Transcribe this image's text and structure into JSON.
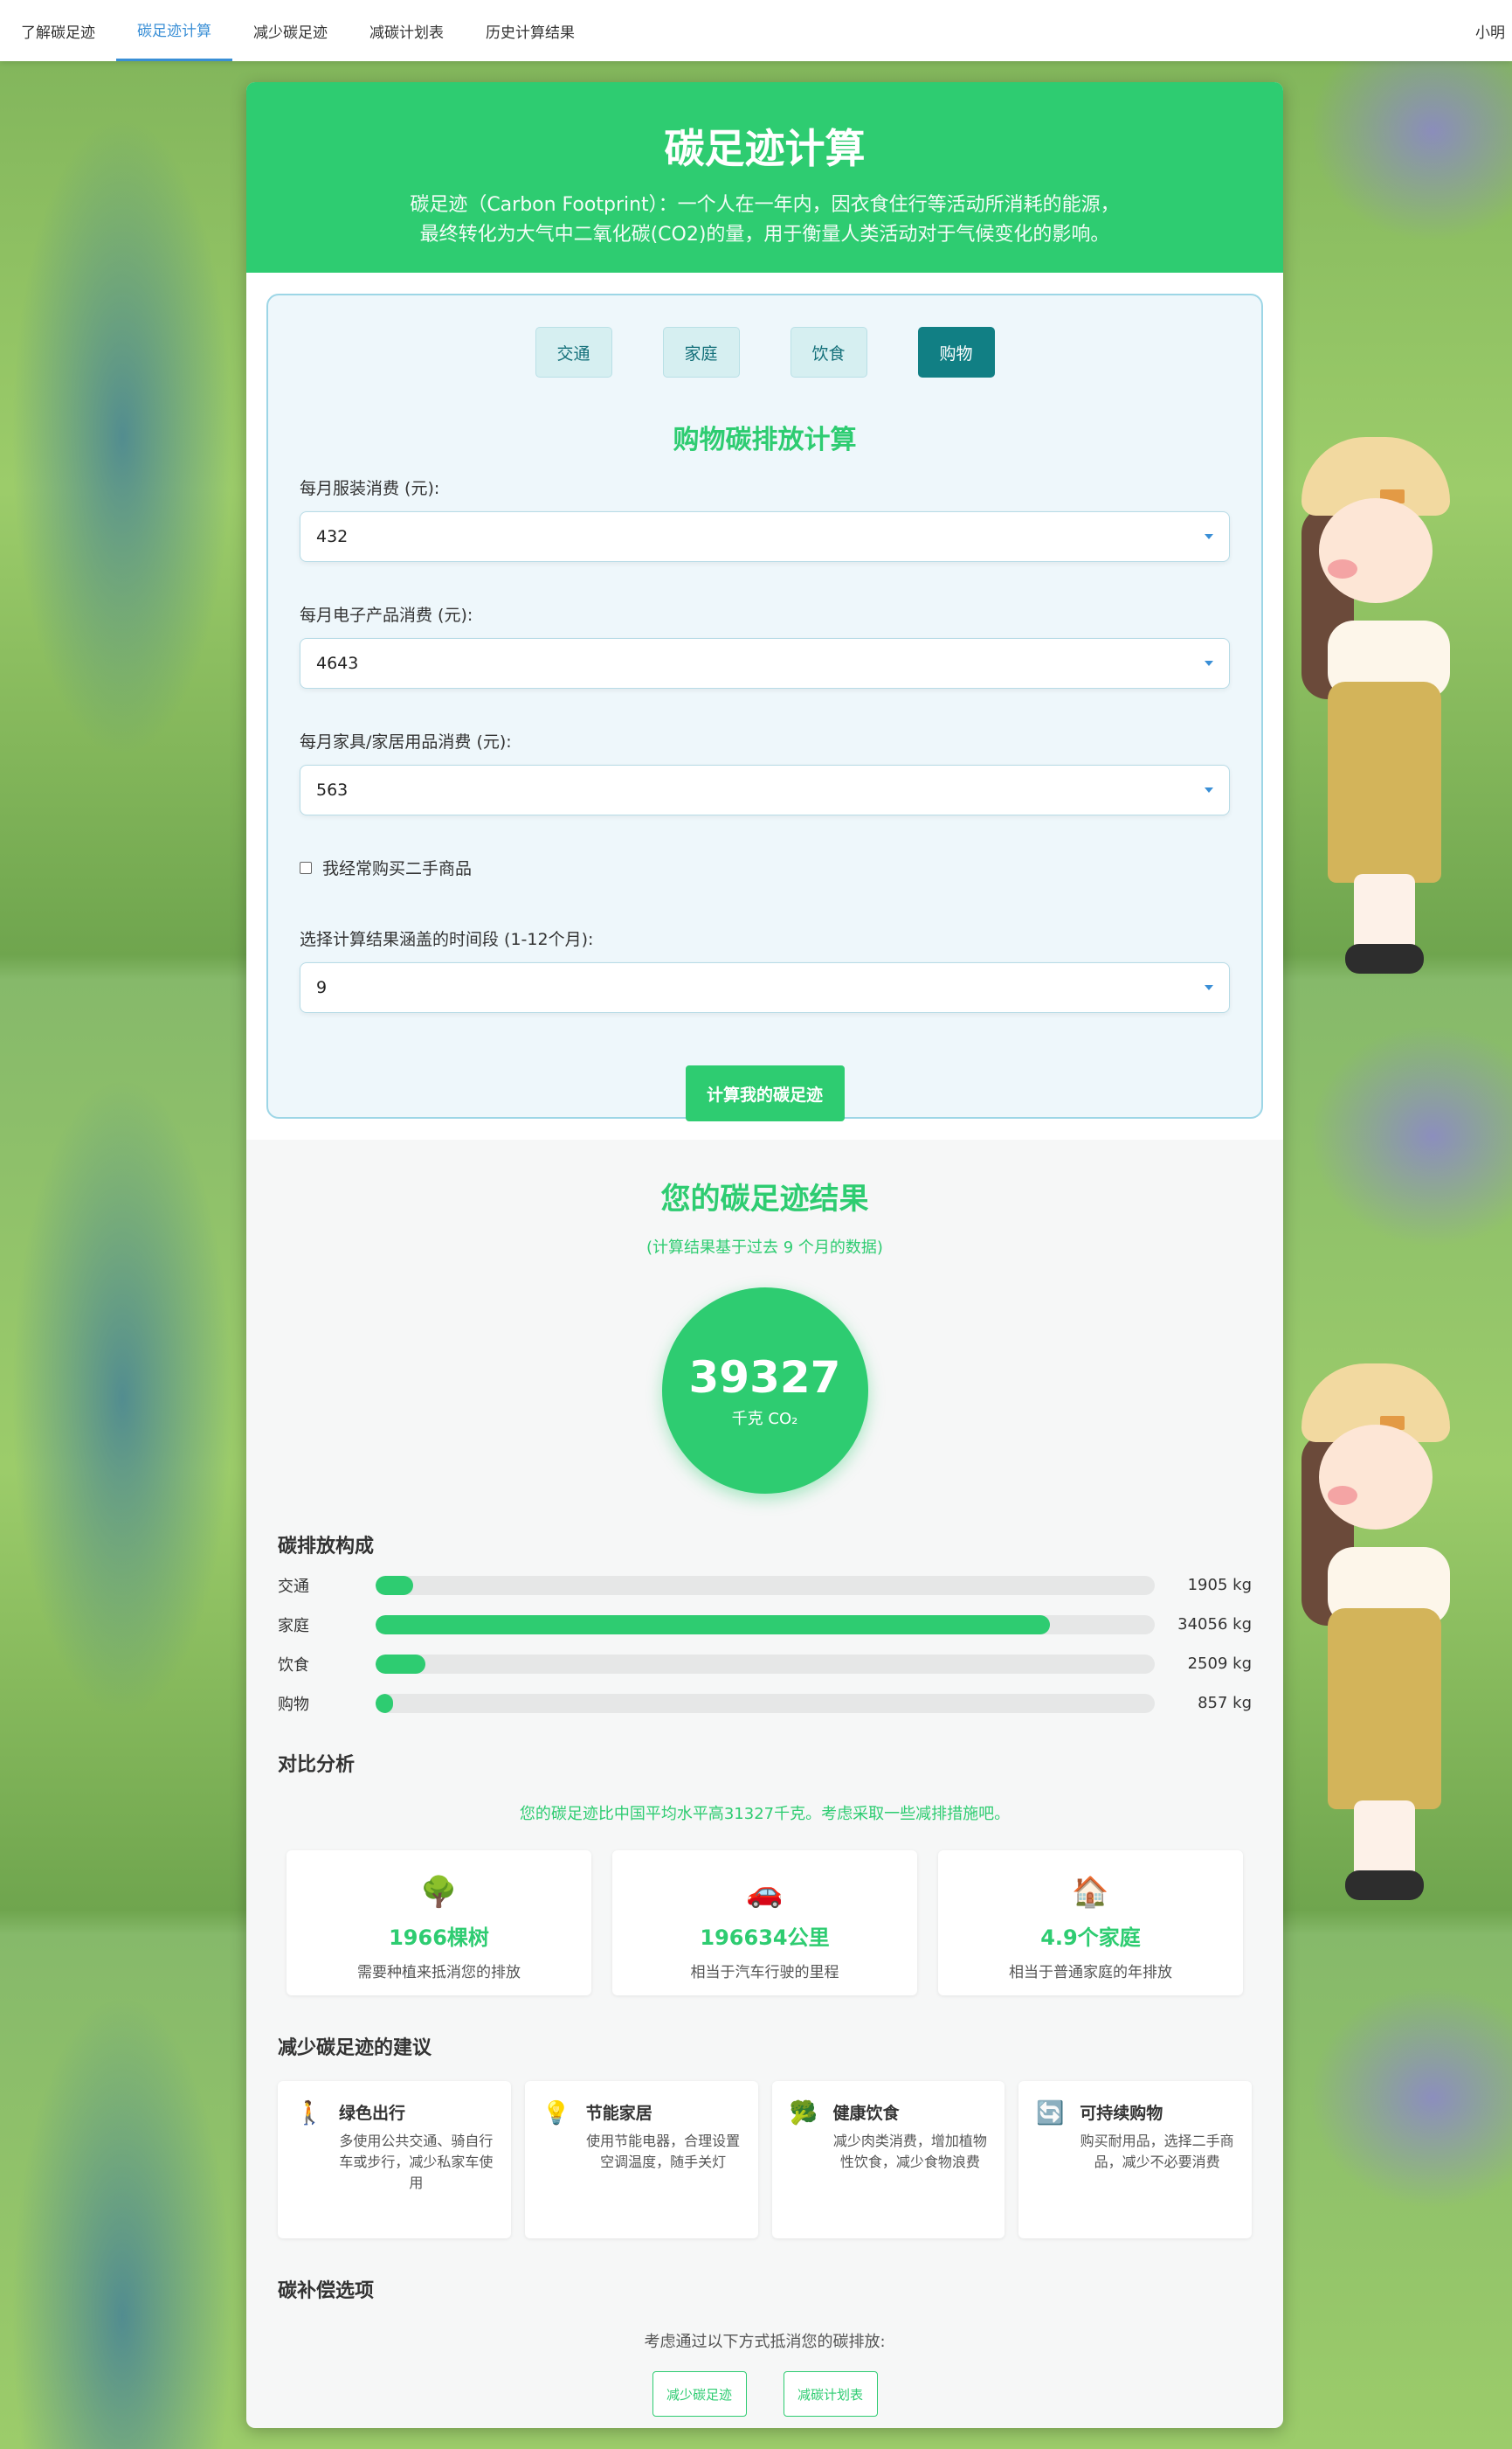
{
  "nav": {
    "items": [
      {
        "label": "了解碳足迹",
        "active": false
      },
      {
        "label": "碳足迹计算",
        "active": true
      },
      {
        "label": "减少碳足迹",
        "active": false
      },
      {
        "label": "减碳计划表",
        "active": false
      },
      {
        "label": "历史计算结果",
        "active": false
      }
    ],
    "user": "小明"
  },
  "hero": {
    "title": "碳足迹计算",
    "desc_line1": "碳足迹（Carbon Footprint）：一个人在一年内，因衣食住行等活动所消耗的能源，",
    "desc_line2": "最终转化为大气中二氧化碳(CO2)的量，用于衡量人类活动对于气候变化的影响。"
  },
  "tabs": [
    {
      "label": "交通",
      "active": false
    },
    {
      "label": "家庭",
      "active": false
    },
    {
      "label": "饮食",
      "active": false
    },
    {
      "label": "购物",
      "active": true
    }
  ],
  "form": {
    "title": "购物碳排放计算",
    "clothing_label": "每月服装消费 (元):",
    "clothing_value": "432",
    "electronics_label": "每月电子产品消费 (元):",
    "electronics_value": "4643",
    "furniture_label": "每月家具/家居用品消费 (元):",
    "furniture_value": "563",
    "secondhand_label": "我经常购买二手商品",
    "secondhand_checked": false,
    "period_label": "选择计算结果涵盖的时间段 (1-12个月):",
    "period_value": "9",
    "submit_label": "计算我的碳足迹"
  },
  "result": {
    "title": "您的碳足迹结果",
    "subtitle": "(计算结果基于过去 9 个月的数据)",
    "total": "39327",
    "unit": "千克 CO₂"
  },
  "breakdown": {
    "title": "碳排放构成",
    "items": [
      {
        "label": "交通",
        "value": "1905 kg",
        "fraction": 0.048
      },
      {
        "label": "家庭",
        "value": "34056 kg",
        "fraction": 0.866
      },
      {
        "label": "饮食",
        "value": "2509 kg",
        "fraction": 0.064
      },
      {
        "label": "购物",
        "value": "857 kg",
        "fraction": 0.022
      }
    ]
  },
  "comparison": {
    "title": "对比分析",
    "text": "您的碳足迹比中国平均水平高31327千克。考虑采取一些减排措施吧。",
    "cards": [
      {
        "icon": "tree-icon",
        "glyph": "🌳",
        "value": "1966棵树",
        "desc": "需要种植来抵消您的排放"
      },
      {
        "icon": "car-icon",
        "glyph": "🚗",
        "value": "196634公里",
        "desc": "相当于汽车行驶的里程"
      },
      {
        "icon": "house-icon",
        "glyph": "🏠",
        "value": "4.9个家庭",
        "desc": "相当于普通家庭的年排放"
      }
    ]
  },
  "tips": {
    "title": "减少碳足迹的建议",
    "items": [
      {
        "icon": "walking-icon",
        "glyph": "🚶",
        "title": "绿色出行",
        "desc": "多使用公共交通、骑自行车或步行，减少私家车使用"
      },
      {
        "icon": "lightbulb-icon",
        "glyph": "💡",
        "title": "节能家居",
        "desc": "使用节能电器，合理设置空调温度，随手关灯"
      },
      {
        "icon": "broccoli-icon",
        "glyph": "🥦",
        "title": "健康饮食",
        "desc": "减少肉类消费，增加植物性饮食，减少食物浪费"
      },
      {
        "icon": "recycle-icon",
        "glyph": "🔄",
        "title": "可持续购物",
        "desc": "购买耐用品，选择二手商品，减少不必要消费"
      }
    ]
  },
  "offset": {
    "title": "碳补偿选项",
    "text": "考虑通过以下方式抵消您的碳排放:",
    "buttons": [
      "减少碳足迹",
      "减碳计划表"
    ]
  },
  "colors": {
    "primary": "#2ecc71",
    "nav_active": "#3a8fd6",
    "tab_active": "#117f84"
  }
}
